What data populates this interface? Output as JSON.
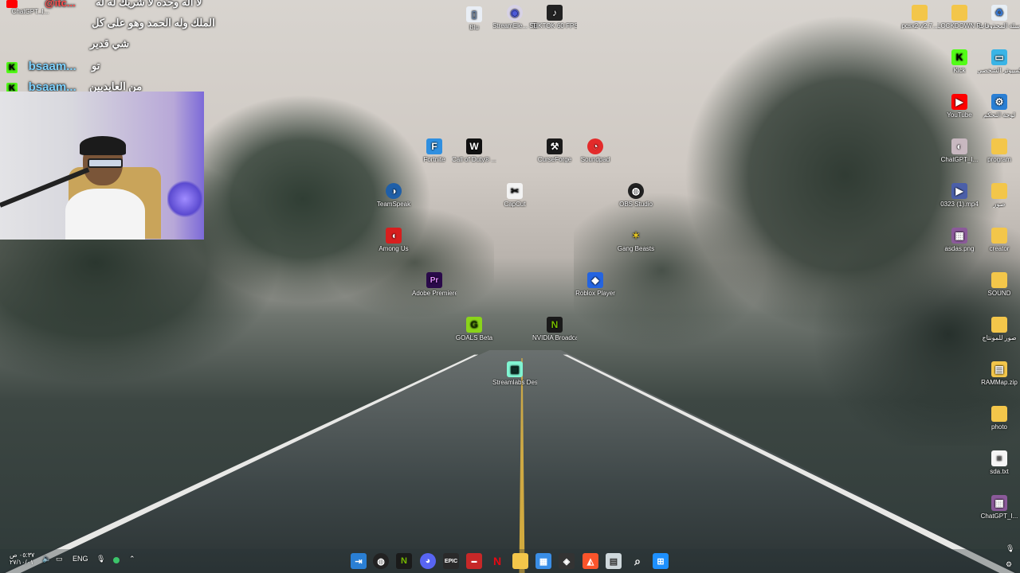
{
  "chat": {
    "top_text": "لا اله وحده لا شريك له له",
    "top_user": "@itc...",
    "line1": "الملك وله الحمد وهو على كل",
    "line2": "شي قدير",
    "messages": [
      {
        "user": "bsaam...",
        "text": "تو"
      },
      {
        "user": "bsaam...",
        "text": "من العايديين"
      }
    ],
    "chatgpt_label": "ChatGPT_I..."
  },
  "desktop_icons": {
    "blu": "Blu",
    "streamelements": "StreamEle... SE.Live",
    "tiktok": "TIKTOK 60 FPS P...",
    "fortnite": "Fortnite",
    "cod": "Call of Duty® ...",
    "curseforge": "CurseForge",
    "soundpad": "Soundpad",
    "teamspeak": "TeamSpeak",
    "capcut": "CapCut",
    "obs": "OBS Studio",
    "amongus": "Among Us",
    "gangbeasts": "Gang Beasts",
    "premiere": "Adobe Premiere P...",
    "roblox": "Roblox Player",
    "goals": "GOALS Beta",
    "nvidia": "NVIDIA Broadcast",
    "streamlabs": "Streamlabs Desktop",
    "pcsx2": "pcsx2-v2.7...",
    "lockdown": "LOCKDOWN Protocol",
    "recycle": "سلة المحذوفات",
    "kick": "Kick",
    "thispc": "هذا الكمبيوتر الشخصي",
    "youtube": "YouTube",
    "controlpanel": "لوحة التحكم",
    "chatgpt2": "ChatGPT_I...",
    "program": "program",
    "mp4": "0323 (1).mp4",
    "photos_ar": "صور",
    "asdas": "asdas.png",
    "creator": "creator",
    "sound": "SOUND",
    "montage": "صور للمونتاج",
    "rammap": "RAMMap.zip",
    "photo": "photo",
    "sda": "sda.txt",
    "chatgpt3": "ChatGPT_I..."
  },
  "taskbar": {
    "lang": "ENG",
    "time": "٠٥:٣٧ ص",
    "date": "٢٧/١٠/٠١"
  },
  "colors": {
    "kick_green": "#53fc18",
    "youtube_red": "#ff0000",
    "folder_yellow": "#f3c64a"
  }
}
